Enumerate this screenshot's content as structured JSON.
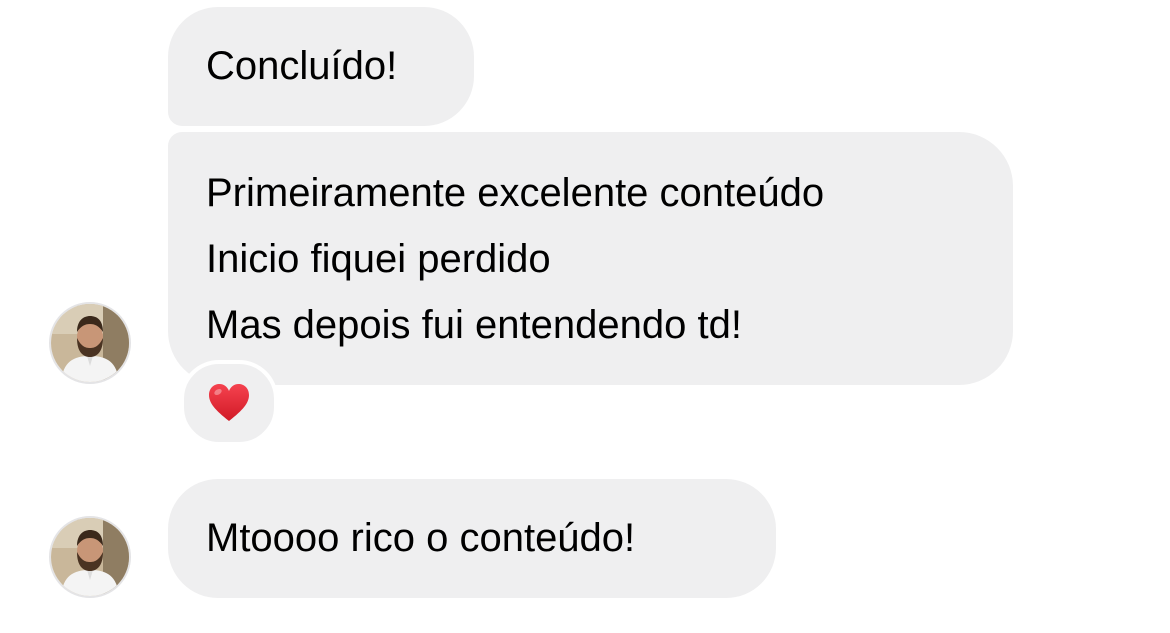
{
  "messages": [
    {
      "lines": [
        "Concluído!"
      ]
    },
    {
      "lines": [
        "Primeiramente excelente conteúdo",
        "Inicio fiquei perdido",
        "Mas depois fui entendendo td!"
      ],
      "reaction": "heart-emoji"
    },
    {
      "lines": [
        "Mtoooo rico o conteúdo!"
      ]
    }
  ],
  "colors": {
    "bubble_background": "#efeff0",
    "text": "#000000",
    "reaction_heart": "#e0202e"
  }
}
